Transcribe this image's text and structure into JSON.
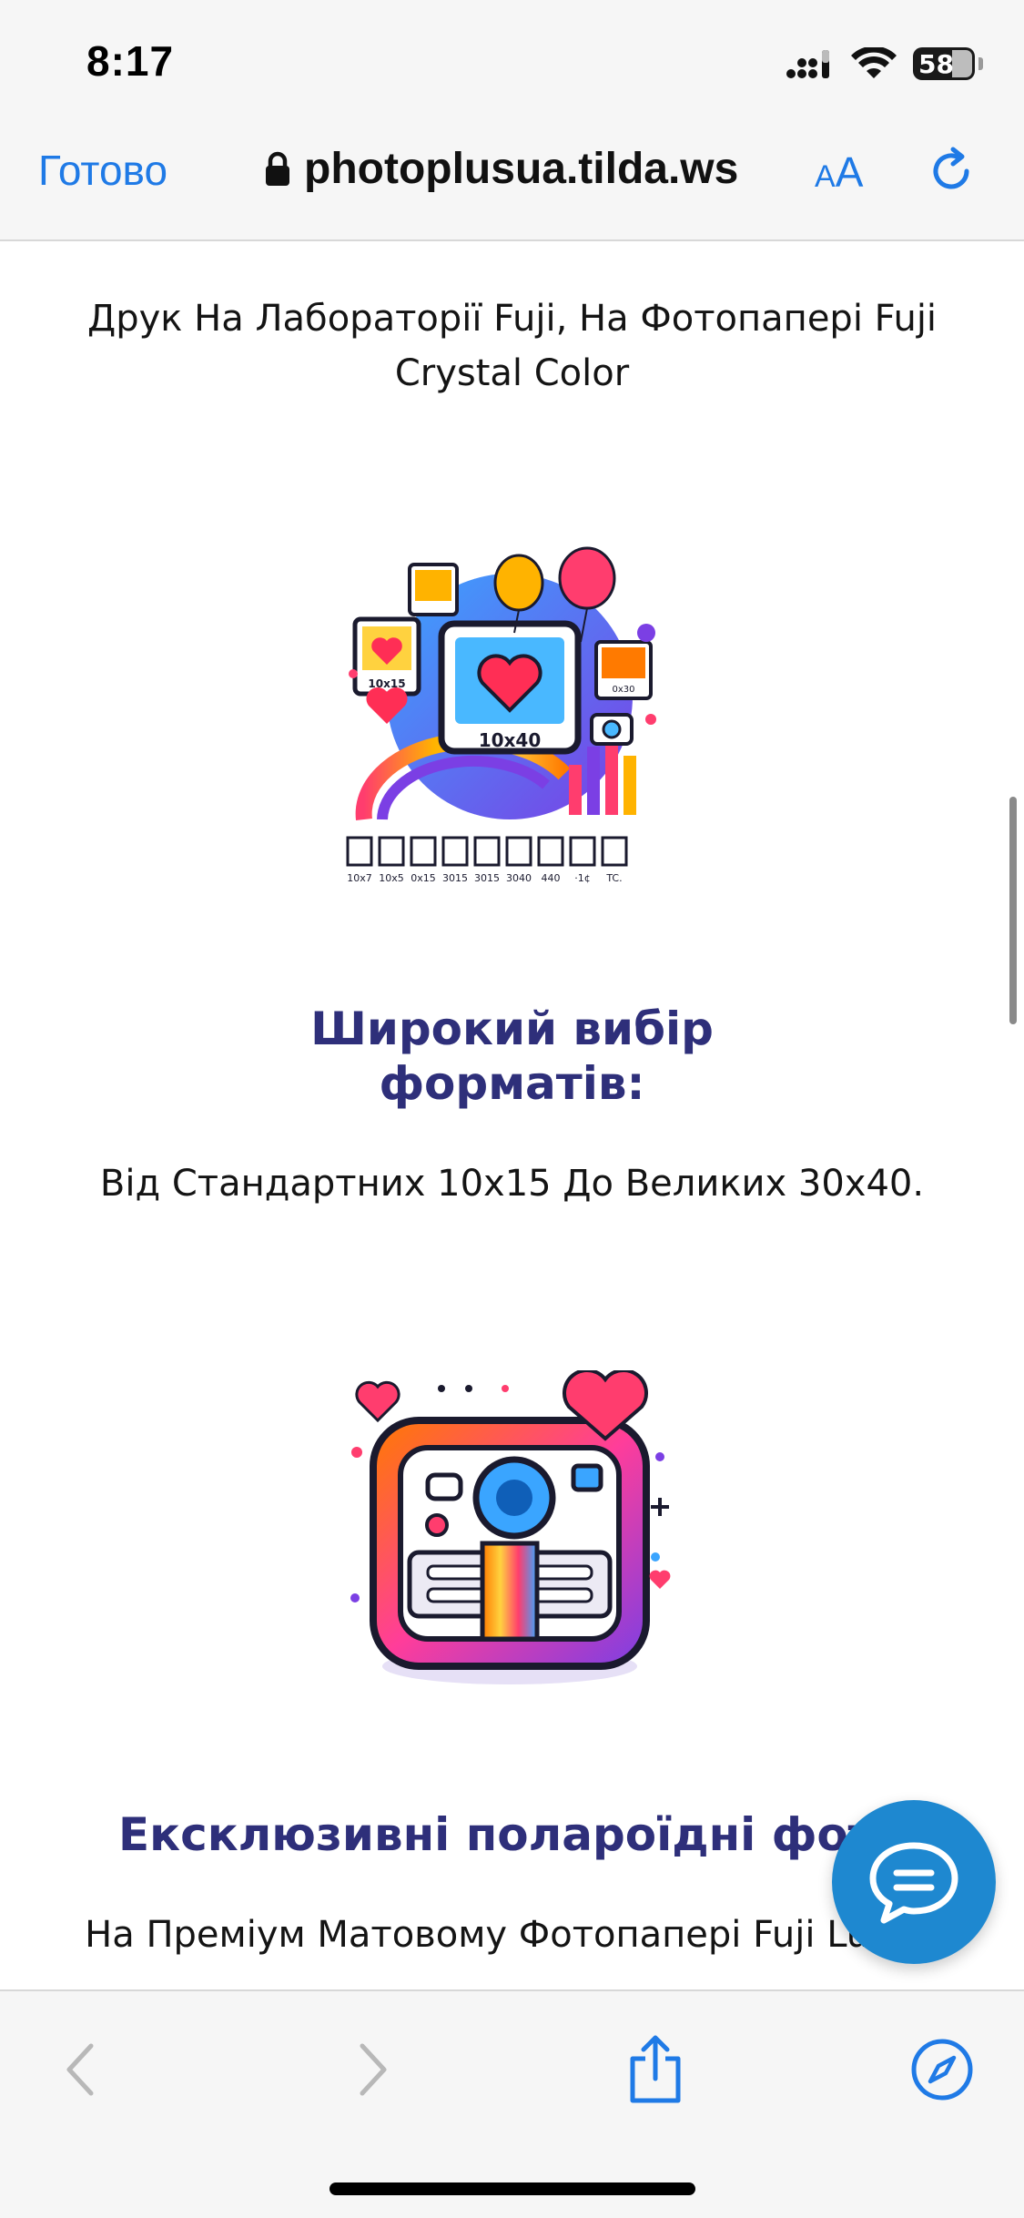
{
  "status_bar": {
    "time": "8:17",
    "battery": "58",
    "battery_level": 0.58,
    "icons": [
      "cellular-signal-icon",
      "wifi-icon",
      "battery-icon"
    ]
  },
  "browser": {
    "done_label": "Готово",
    "url": "photoplusua.tilda.ws",
    "text_size_label_small": "A",
    "text_size_label_large": "A",
    "icons": [
      "lock-icon",
      "reload-icon",
      "back-icon",
      "forward-icon",
      "share-icon",
      "compass-icon"
    ]
  },
  "sections": [
    {
      "description_lines": [
        "Друк На Лабораторії Fuji, На Фотопапері Fuji",
        "Crystal Color"
      ]
    },
    {
      "illustration": "photo-formats-illustration",
      "illustration_labels": {
        "center": "10x40",
        "left": "10x15",
        "right": "0x30",
        "strip": [
          "10x7",
          "10x5",
          "0x15",
          "3015",
          "3015",
          "3040",
          "440",
          "·1¢",
          "TC."
        ]
      },
      "heading_lines": [
        "Широкий вибір",
        "форматів:"
      ],
      "description": "Від Стандартних 10x15 До Великих 30x40."
    },
    {
      "illustration": "polaroid-camera-illustration",
      "heading": "Ексклюзивні полароїдні фото",
      "description": "На Преміум Матовому Фотопапері Fuji Lustre"
    }
  ],
  "colors": {
    "link_blue": "#1f7ae6",
    "heading_navy": "#2e2f7a",
    "chat_button": "#1e88d0",
    "toolbar_bg": "#f6f6f6"
  },
  "chat_button_icon": "chat-bubble-icon"
}
